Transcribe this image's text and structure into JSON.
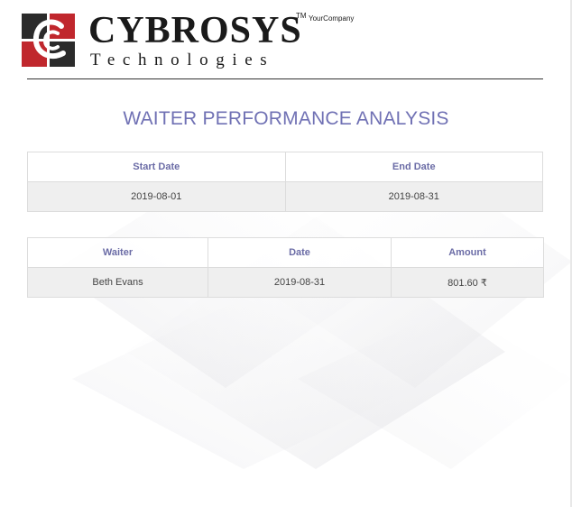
{
  "brand": {
    "logo_icon": "cybrosys-logo-icon",
    "name": "CYBROSYS",
    "tm": "TM",
    "company": "YourCompany",
    "subtitle": "Technologies"
  },
  "report": {
    "title": "WAITER PERFORMANCE ANALYSIS"
  },
  "date_range": {
    "headers": [
      "Start Date",
      "End Date"
    ],
    "values": [
      "2019-08-01",
      "2019-08-31"
    ]
  },
  "waiters": {
    "headers": [
      "Waiter",
      "Date",
      "Amount"
    ],
    "rows": [
      [
        "Beth Evans",
        "2019-08-31",
        "801.60 ₹"
      ]
    ]
  },
  "colors": {
    "title": "#7071b4",
    "header_text": "#6b6ca6",
    "logo_red": "#c0272d",
    "logo_dark": "#2b2b2b"
  }
}
